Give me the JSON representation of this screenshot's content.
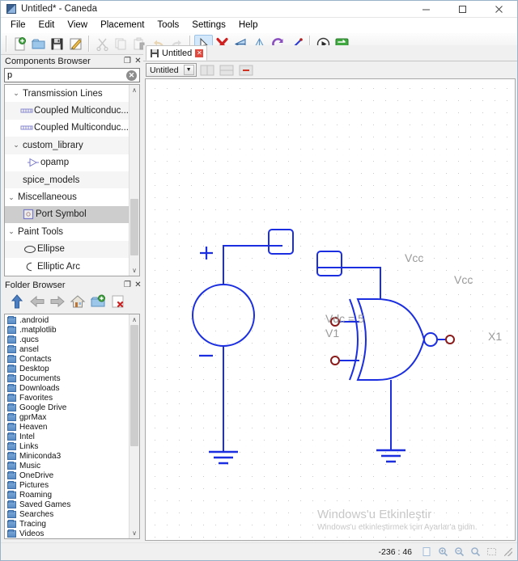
{
  "window": {
    "title": "Untitled* - Caneda",
    "app_icon": "app-icon",
    "minimize": "–",
    "maximize": "☐",
    "close": "✕"
  },
  "menubar": {
    "items": [
      {
        "label": "File"
      },
      {
        "label": "Edit"
      },
      {
        "label": "View"
      },
      {
        "label": "Placement"
      },
      {
        "label": "Tools"
      },
      {
        "label": "Settings"
      },
      {
        "label": "Help"
      }
    ]
  },
  "toolbar": {
    "groups": [
      {
        "buttons": [
          {
            "name": "new-document-button",
            "icon": "new-file-icon",
            "state": "enabled"
          },
          {
            "name": "open-document-button",
            "icon": "open-folder-icon",
            "state": "enabled"
          },
          {
            "name": "save-document-button",
            "icon": "save-icon",
            "state": "enabled"
          },
          {
            "name": "print-document-button",
            "icon": "print-edit-icon",
            "state": "enabled"
          }
        ]
      },
      {
        "buttons": [
          {
            "name": "cut-button",
            "icon": "scissors-icon",
            "state": "disabled"
          },
          {
            "name": "copy-button",
            "icon": "copy-icon",
            "state": "disabled"
          },
          {
            "name": "paste-button",
            "icon": "paste-icon",
            "state": "disabled"
          },
          {
            "name": "undo-button",
            "icon": "undo-arrow-icon",
            "state": "disabled"
          },
          {
            "name": "redo-button",
            "icon": "redo-arrow-icon",
            "state": "disabled"
          }
        ]
      },
      {
        "buttons": [
          {
            "name": "select-tool-button",
            "icon": "cursor-arrow-icon",
            "state": "checked"
          },
          {
            "name": "delete-button",
            "icon": "red-x-icon",
            "state": "enabled"
          },
          {
            "name": "rotate-button",
            "icon": "blue-triangle-icon",
            "state": "enabled"
          },
          {
            "name": "mirror-x-button",
            "icon": "mirror-triangle-icon",
            "state": "enabled"
          },
          {
            "name": "mirror-y-button",
            "icon": "purple-swirl-icon",
            "state": "enabled"
          },
          {
            "name": "wire-tool-button",
            "icon": "diagonal-wire-icon",
            "state": "enabled"
          }
        ]
      },
      {
        "buttons": [
          {
            "name": "simulate-button",
            "icon": "play-circle-icon",
            "state": "enabled"
          },
          {
            "name": "open-simulation-button",
            "icon": "green-exchange-icon",
            "state": "enabled"
          }
        ]
      }
    ]
  },
  "components_browser": {
    "title": "Components Browser",
    "float_button": "❐",
    "close_button": "✕",
    "search": {
      "value": "p",
      "placeholder": ""
    },
    "clear_icon": "✕",
    "tree": [
      {
        "indent": 0,
        "twisty": "⌄",
        "icon": "",
        "label": "Transmission Lines",
        "selected": false
      },
      {
        "indent": 1,
        "twisty": "",
        "icon": "multiconductor-icon",
        "label": "Coupled Multiconduc...",
        "selected": false
      },
      {
        "indent": 1,
        "twisty": "",
        "icon": "multiconductor-icon",
        "label": "Coupled Multiconduc...",
        "selected": false
      },
      {
        "indent": 0,
        "twisty": "⌄",
        "icon": "",
        "label": "custom_library",
        "selected": false
      },
      {
        "indent": 1,
        "twisty": "",
        "icon": "opamp-icon",
        "label": "opamp",
        "selected": false
      },
      {
        "indent": 0,
        "twisty": "",
        "icon": "",
        "label": "spice_models",
        "selected": false
      },
      {
        "indent": 0,
        "twisty": "⌄",
        "icon": "",
        "label": "Miscellaneous",
        "selected": false
      },
      {
        "indent": 1,
        "twisty": "",
        "icon": "port-symbol-icon",
        "label": "Port Symbol",
        "selected": true
      },
      {
        "indent": 0,
        "twisty": "⌄",
        "icon": "",
        "label": "Paint Tools",
        "selected": false
      },
      {
        "indent": 1,
        "twisty": "",
        "icon": "ellipse-icon",
        "label": "Ellipse",
        "selected": false
      },
      {
        "indent": 1,
        "twisty": "",
        "icon": "elliptic-arc-icon",
        "label": "Elliptic Arc",
        "selected": false
      }
    ],
    "scroll_up": "∧",
    "scroll_down": "∨"
  },
  "folder_browser": {
    "title": "Folder Browser",
    "float_button": "❐",
    "close_button": "✕",
    "toolbar": [
      {
        "name": "parent-folder-button",
        "icon": "up-arrow-icon"
      },
      {
        "name": "back-button",
        "icon": "left-arrow-icon"
      },
      {
        "name": "forward-button",
        "icon": "right-arrow-icon"
      },
      {
        "name": "home-button",
        "icon": "home-icon"
      },
      {
        "name": "new-folder-button",
        "icon": "new-folder-icon"
      },
      {
        "name": "delete-file-button",
        "icon": "delete-file-icon"
      }
    ],
    "folders": [
      ".android",
      ".matplotlib",
      ".qucs",
      "ansel",
      "Contacts",
      "Desktop",
      "Documents",
      "Downloads",
      "Favorites",
      "Google Drive",
      "gprMax",
      "Heaven",
      "Intel",
      "Links",
      "Miniconda3",
      "Music",
      "OneDrive",
      "Pictures",
      "Roaming",
      "Saved Games",
      "Searches",
      "Tracing",
      "Videos"
    ],
    "scroll_up": "∧",
    "scroll_down": "∨"
  },
  "document": {
    "tab_label": "Untitled",
    "tab_close": "✕",
    "select_value": "Untitled",
    "select_arrow": "▼",
    "view_buttons": [
      {
        "name": "split-horizontal-button",
        "icon": "split-horizontal-icon",
        "state": "disabled"
      },
      {
        "name": "split-vertical-button",
        "icon": "split-vertical-icon",
        "state": "disabled"
      },
      {
        "name": "close-split-button",
        "icon": "close-split-icon",
        "state": "enabled"
      }
    ]
  },
  "schematic": {
    "wire_color": "#1b2fe0",
    "label_color": "#9a9a9a",
    "pin_color": "#8b1a1a",
    "components": [
      {
        "name": "voltage-source-v1",
        "type": "dc-voltage-source",
        "plus_sign": "+",
        "minus_sign": "−",
        "labels": [
          "Vdc = 5",
          "V1"
        ]
      },
      {
        "name": "port-symbol-vcc-left",
        "type": "port",
        "label": "Vcc"
      },
      {
        "name": "port-symbol-vcc-right",
        "type": "port",
        "label": "Vcc"
      },
      {
        "name": "xnor-gate-x1",
        "type": "xnor-gate",
        "label": "X1"
      },
      {
        "name": "ground-left",
        "type": "ground",
        "label": ""
      },
      {
        "name": "ground-right",
        "type": "ground",
        "label": ""
      }
    ]
  },
  "watermark": {
    "line1": "Windows'u Etkinleştir",
    "line2": "Windows'u etkinleştirmek için Ayarlar'a gidin."
  },
  "statusbar": {
    "coordinates": "-236 : 46",
    "buttons": [
      {
        "name": "zoom-fit-button",
        "icon": "page-icon"
      },
      {
        "name": "zoom-in-button",
        "icon": "magnifier-plus-icon"
      },
      {
        "name": "zoom-out-button",
        "icon": "magnifier-minus-icon"
      },
      {
        "name": "zoom-original-button",
        "icon": "magnifier-icon"
      },
      {
        "name": "zoom-selection-button",
        "icon": "selection-icon"
      }
    ]
  }
}
